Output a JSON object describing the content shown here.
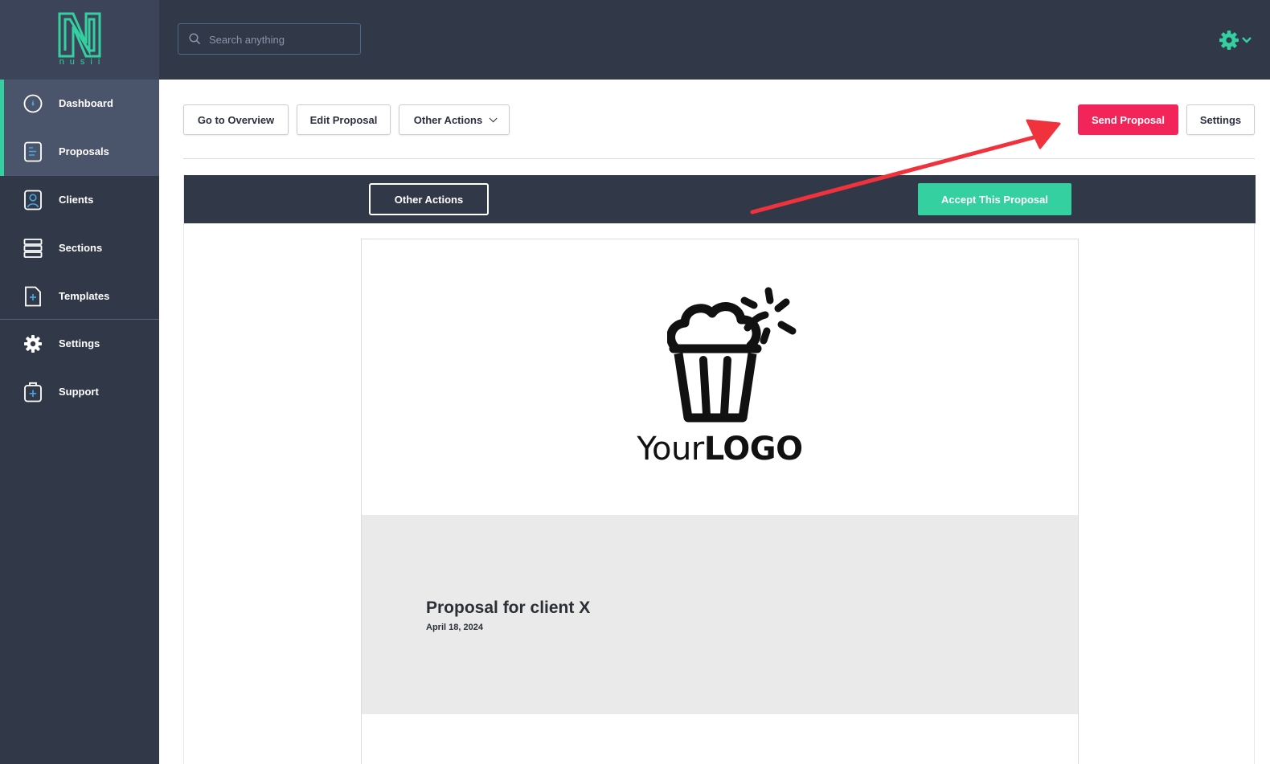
{
  "brand": {
    "name": "nusii",
    "accent": "#35d0a0"
  },
  "sidebar": {
    "items": [
      {
        "label": "Dashboard",
        "icon": "dashboard-icon",
        "active": true
      },
      {
        "label": "Proposals",
        "icon": "document-icon",
        "active": true
      },
      {
        "label": "Clients",
        "icon": "client-icon",
        "active": false
      },
      {
        "label": "Sections",
        "icon": "sections-icon",
        "active": false
      },
      {
        "label": "Templates",
        "icon": "template-add-icon",
        "active": false
      },
      {
        "label": "Settings",
        "icon": "gear-icon",
        "active": false
      },
      {
        "label": "Support",
        "icon": "support-kit-icon",
        "active": false
      }
    ]
  },
  "topbar": {
    "search": {
      "placeholder": "Search anything",
      "value": ""
    },
    "settings_menu_icon": "gear-icon"
  },
  "toolbar": {
    "overview_label": "Go to Overview",
    "edit_label": "Edit Proposal",
    "other_actions_label": "Other Actions",
    "send_label": "Send Proposal",
    "settings_label": "Settings"
  },
  "preview": {
    "other_actions_label": "Other Actions",
    "accept_label": "Accept This Proposal",
    "logo": {
      "text_light": "Your",
      "text_bold": "LOGO"
    },
    "cover": {
      "title": "Proposal for client X",
      "date": "April 18, 2024"
    }
  },
  "colors": {
    "sidebar_bg": "#313848",
    "primary_button": "#f2255a",
    "accept_button": "#35d0a0",
    "annotation_arrow": "#f0323c"
  }
}
